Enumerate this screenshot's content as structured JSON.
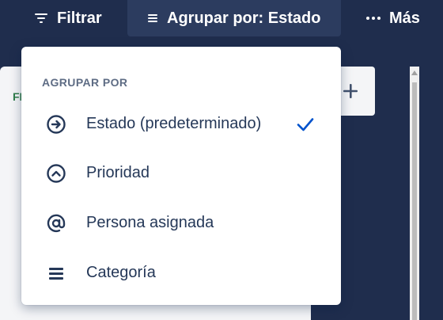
{
  "toolbar": {
    "filter_label": "Filtrar",
    "group_label": "Agrupar por: Estado",
    "more_label": "Más"
  },
  "board": {
    "column_status_label": "FI"
  },
  "menu": {
    "heading": "AGRUPAR POR",
    "selected": "Estado (predeterminado)",
    "items": [
      {
        "label": "Estado (predeterminado)",
        "icon": "circle-arrow-right-icon",
        "selected": true
      },
      {
        "label": "Prioridad",
        "icon": "circle-chevron-up-icon",
        "selected": false
      },
      {
        "label": "Persona asignada",
        "icon": "at-sign-icon",
        "selected": false
      },
      {
        "label": "Categoría",
        "icon": "hamburger-lines-icon",
        "selected": false
      }
    ]
  },
  "colors": {
    "background": "#1f2d4d",
    "toolbar_active": "#2c3c5f",
    "menu_text": "#253858",
    "heading_text": "#5e6c84",
    "check_accent": "#0052cc",
    "status_green": "#2f7d4a"
  }
}
